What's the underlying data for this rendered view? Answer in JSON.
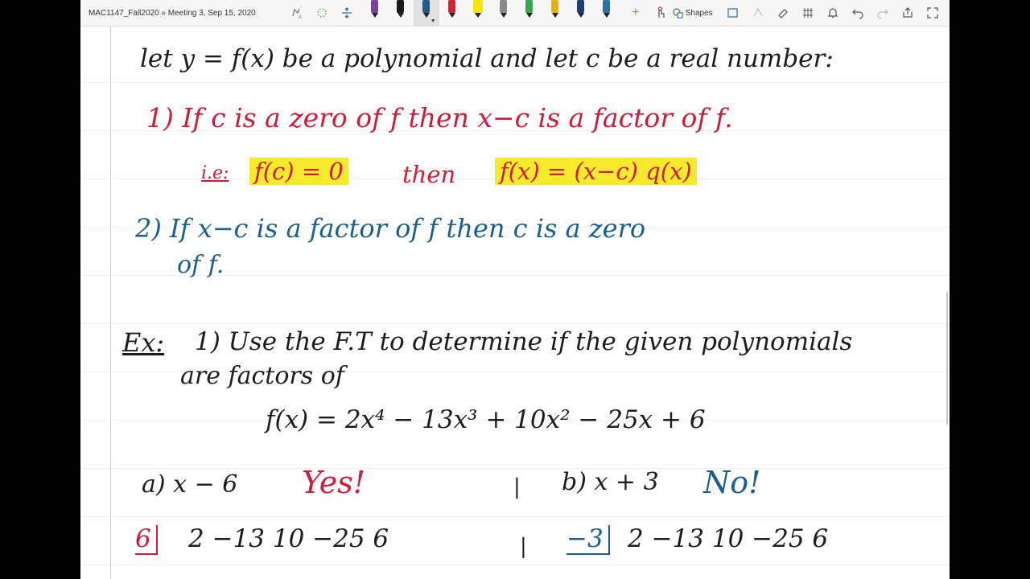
{
  "toolbar": {
    "breadcrumb": "MAC1147_Fall2020 » Meeting 3, Sep 15, 2020",
    "shapes_label": "Shapes",
    "pens": [
      {
        "name": "pen-purple",
        "color": "#7a3fa0"
      },
      {
        "name": "pen-black",
        "color": "#1a1a1a"
      },
      {
        "name": "pen-blue-active",
        "color": "#1e5b8a"
      },
      {
        "name": "pen-red",
        "color": "#d92034"
      },
      {
        "name": "highlighter-yellow",
        "color": "#f2e60a"
      },
      {
        "name": "pen-gray",
        "color": "#8a8a8a"
      },
      {
        "name": "pen-green",
        "color": "#33a84a"
      },
      {
        "name": "pen-gold",
        "color": "#e8b100"
      },
      {
        "name": "pen-navy",
        "color": "#1f3e78"
      },
      {
        "name": "pen-teal",
        "color": "#2d6fa6"
      }
    ]
  },
  "notes": {
    "line1": "let  y = f(x)  be a polynomial and let c be a real number:",
    "item1": "1)  If  c  is a zero of  f   then  x−c  is a factor of f.",
    "ie_label": "i.e:",
    "ie_hl1": "f(c) = 0",
    "ie_then": "then",
    "ie_hl2": "f(x) = (x−c) q(x)",
    "item2_a": "2)  If  x−c  is  a  factor  of  f   then  c  is  a  zero",
    "item2_b": "of  f.",
    "ex_label": "Ex:",
    "ex_text": "1)  Use the F.T  to determine if the given polynomials",
    "ex_text2": "are factors of",
    "poly": "f(x) = 2x⁴ − 13x³ + 10x² − 25x + 6",
    "a_label": "a)  x − 6",
    "a_answer": "Yes!",
    "b_label": "b)  x + 3",
    "b_answer": "No!",
    "syn_a_div": "6",
    "syn_a_coeffs": "2    −13    10   −25    6",
    "syn_b_div": "−3",
    "syn_b_coeffs": "2    −13    10   −25    6",
    "sep1": "|",
    "sep2": "|"
  },
  "colors": {
    "margin": "#f2b9b9",
    "highlight": "#f7ea2c",
    "red_ink": "#cf1c3a",
    "blue_ink": "#1d5f8c",
    "black_ink": "#1d1d1d"
  }
}
